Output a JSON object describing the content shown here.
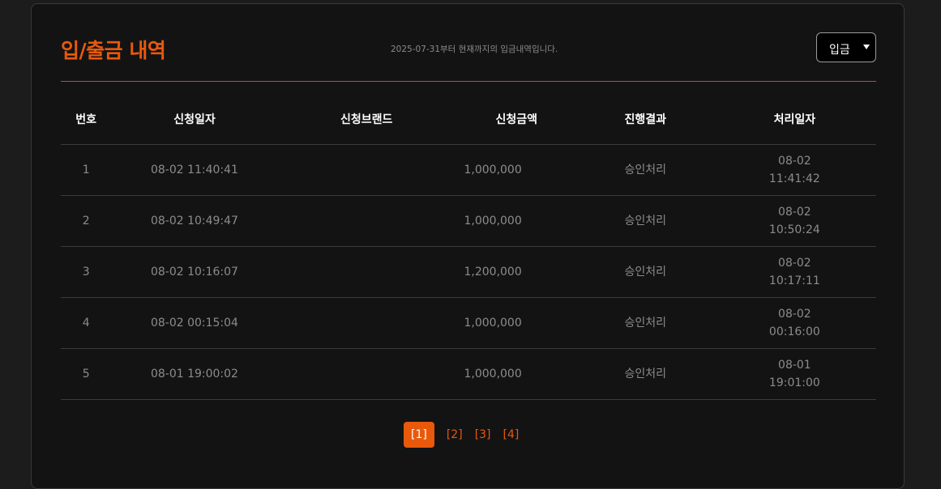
{
  "header": {
    "title": "입/출금 내역",
    "subtitle": "2025-07-31부터 현재까지의 입금내역입니다.",
    "filter_value": "입금"
  },
  "table": {
    "columns": [
      "번호",
      "신청일자",
      "신청브랜드",
      "신청금액",
      "진행결과",
      "처리일자"
    ],
    "rows": [
      {
        "no": "1",
        "date": "08-02 11:40:41",
        "brand": "",
        "amount": "1,000,000",
        "status": "승인처리",
        "done_date": "08-02",
        "done_time": "11:41:42"
      },
      {
        "no": "2",
        "date": "08-02 10:49:47",
        "brand": "",
        "amount": "1,000,000",
        "status": "승인처리",
        "done_date": "08-02",
        "done_time": "10:50:24"
      },
      {
        "no": "3",
        "date": "08-02 10:16:07",
        "brand": "",
        "amount": "1,200,000",
        "status": "승인처리",
        "done_date": "08-02",
        "done_time": "10:17:11"
      },
      {
        "no": "4",
        "date": "08-02 00:15:04",
        "brand": "",
        "amount": "1,000,000",
        "status": "승인처리",
        "done_date": "08-02",
        "done_time": "00:16:00"
      },
      {
        "no": "5",
        "date": "08-01 19:00:02",
        "brand": "",
        "amount": "1,000,000",
        "status": "승인처리",
        "done_date": "08-01",
        "done_time": "19:01:00"
      }
    ]
  },
  "pagination": {
    "pages": [
      "[1]",
      "[2]",
      "[3]",
      "[4]"
    ],
    "active_index": 0
  },
  "colors": {
    "accent": "#e8590c",
    "background": "#131313",
    "muted_text": "#8c8c8c"
  }
}
